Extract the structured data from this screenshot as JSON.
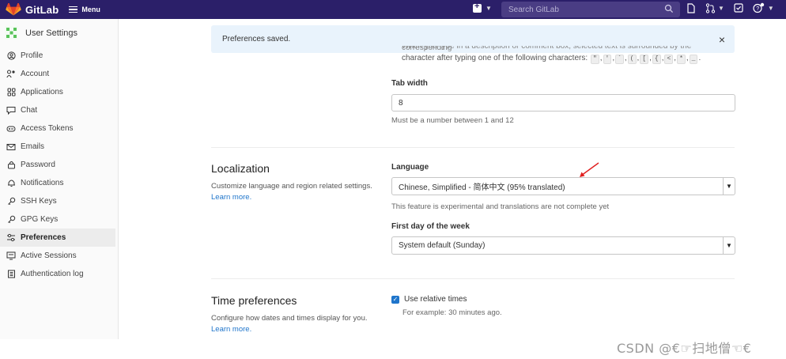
{
  "topbar": {
    "brand": "GitLab",
    "menu_label": "Menu",
    "search_placeholder": "Search GitLab",
    "colors": {
      "bg": "#2b1f69",
      "search_bg": "#4a3d84"
    }
  },
  "sidebar": {
    "title": "User Settings",
    "items": [
      {
        "label": "Profile",
        "icon": "profile-icon"
      },
      {
        "label": "Account",
        "icon": "account-icon"
      },
      {
        "label": "Applications",
        "icon": "applications-icon"
      },
      {
        "label": "Chat",
        "icon": "chat-icon"
      },
      {
        "label": "Access Tokens",
        "icon": "token-icon"
      },
      {
        "label": "Emails",
        "icon": "email-icon"
      },
      {
        "label": "Password",
        "icon": "lock-icon"
      },
      {
        "label": "Notifications",
        "icon": "bell-icon"
      },
      {
        "label": "SSH Keys",
        "icon": "key-icon"
      },
      {
        "label": "GPG Keys",
        "icon": "key-icon"
      },
      {
        "label": "Preferences",
        "icon": "preferences-icon",
        "active": true
      },
      {
        "label": "Active Sessions",
        "icon": "monitor-icon"
      },
      {
        "label": "Authentication log",
        "icon": "log-icon"
      }
    ]
  },
  "flash": {
    "message": "Preferences saved.",
    "close": "×"
  },
  "behavior": {
    "cut_line": "When you type in a description or comment box, selected text is surrounded by the corresponding",
    "text_before_keys": "character after typing one of the following characters:",
    "keys": [
      "\"",
      "'",
      "`",
      "(",
      "[",
      "{",
      "<",
      "*",
      "_"
    ]
  },
  "tab_width": {
    "label": "Tab width",
    "value": "8",
    "help": "Must be a number between 1 and 12"
  },
  "localization": {
    "title": "Localization",
    "description": "Customize language and region related settings.",
    "learn_more": "Learn more.",
    "language_label": "Language",
    "language_value": "Chinese, Simplified - 简体中文 (95% translated)",
    "language_help": "This feature is experimental and translations are not complete yet",
    "first_day_label": "First day of the week",
    "first_day_value": "System default (Sunday)"
  },
  "time_preferences": {
    "title": "Time preferences",
    "description": "Configure how dates and times display for you.",
    "learn_more": "Learn more.",
    "relative_label": "Use relative times",
    "relative_checked": true,
    "relative_example": "For example: 30 minutes ago."
  },
  "watermark": "CSDN @€☞扫地僧☜€",
  "colors": {
    "link": "#1f75cb",
    "annotation_arrow": "#e02020",
    "active_item_bg": "#ececec"
  }
}
